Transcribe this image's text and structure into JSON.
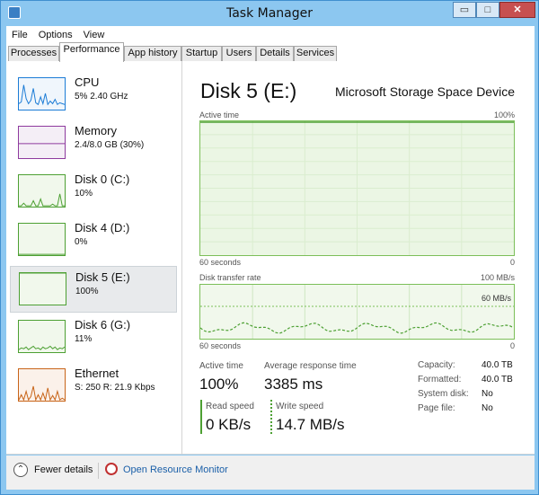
{
  "window": {
    "title": "Task Manager"
  },
  "controls": {
    "minimize": "▭",
    "maximize": "□",
    "close": "✕"
  },
  "menu": [
    "File",
    "Options",
    "View"
  ],
  "tabs": [
    "Processes",
    "Performance",
    "App history",
    "Startup",
    "Users",
    "Details",
    "Services"
  ],
  "active_tab": "Performance",
  "sidebar": [
    {
      "name": "CPU",
      "sub": "5% 2.40 GHz",
      "color": "#1c7cd6",
      "fill": "#f0f6fc"
    },
    {
      "name": "Memory",
      "sub": "2.4/8.0 GB (30%)",
      "color": "#8e3a9e",
      "fill": "#f4eef6"
    },
    {
      "name": "Disk 0 (C:)",
      "sub": "10%",
      "color": "#4da033",
      "fill": "#f1f8ec"
    },
    {
      "name": "Disk 4 (D:)",
      "sub": "0%",
      "color": "#4da033",
      "fill": "#f1f8ec"
    },
    {
      "name": "Disk 5 (E:)",
      "sub": "100%",
      "color": "#4da033",
      "fill": "#f1f8ec"
    },
    {
      "name": "Disk 6 (G:)",
      "sub": "11%",
      "color": "#4da033",
      "fill": "#f1f8ec"
    },
    {
      "name": "Ethernet",
      "sub": "S: 250  R: 21.9 Kbps",
      "color": "#c86418",
      "fill": "#fbf1ea"
    }
  ],
  "selected_item": "Disk 5 (E:)",
  "main": {
    "title": "Disk 5 (E:)",
    "model": "Microsoft Storage Space Device",
    "active_time": {
      "label": "Active time",
      "max": "100%",
      "xlabel": "60 seconds",
      "min": "0",
      "value_percent": 100
    },
    "transfer": {
      "label": "Disk transfer rate",
      "max": "100 MB/s",
      "midline": "60 MB/s",
      "xlabel": "60 seconds",
      "min": "0"
    },
    "stats": {
      "active_time_label": "Active time",
      "active_time_value": "100%",
      "response_label": "Average response time",
      "response_value": "3385 ms",
      "read_label": "Read speed",
      "read_value": "0 KB/s",
      "write_label": "Write speed",
      "write_value": "14.7 MB/s"
    },
    "info": [
      {
        "key": "Capacity:",
        "value": "40.0 TB"
      },
      {
        "key": "Formatted:",
        "value": "40.0 TB"
      },
      {
        "key": "System disk:",
        "value": "No"
      },
      {
        "key": "Page file:",
        "value": "No"
      }
    ]
  },
  "footer": {
    "fewer_details": "Fewer details",
    "open_resource_monitor": "Open Resource Monitor"
  },
  "accent": "#4da033"
}
